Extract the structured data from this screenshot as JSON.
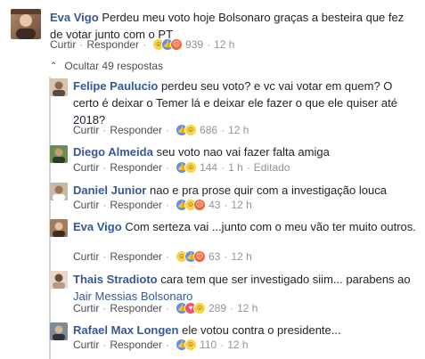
{
  "main_comment": {
    "author": "Eva Vigo",
    "text": "Perdeu meu voto hoje Bolsonaro graças a besteira que fez de votar junto com o PT",
    "like": "Curtir",
    "reply": "Responder",
    "reaction_count": "939",
    "time": "12 h",
    "reactions": [
      "haha",
      "like",
      "angry"
    ]
  },
  "toggle": {
    "label": "Ocultar 49 respostas"
  },
  "replies": [
    {
      "author": "Felipe Paulucio",
      "text": "perdeu seu voto? e vc vai votar em quem? O certo é deixar o Temer lá e deixar ele fazer o que ele quiser até 2018?",
      "like": "Curtir",
      "reply": "Responder",
      "reaction_count": "686",
      "time": "12 h",
      "edited": "",
      "reactions": [
        "like",
        "haha"
      ]
    },
    {
      "author": "Diego Almeida",
      "text": "seu voto nao vai fazer falta amiga",
      "like": "Curtir",
      "reply": "Responder",
      "reaction_count": "144",
      "time": "1 h",
      "edited": "Editado",
      "reactions": [
        "like",
        "haha"
      ]
    },
    {
      "author": "Daniel Junior",
      "text": "nao e pra prose quir com a investigação louca",
      "like": "Curtir",
      "reply": "Responder",
      "reaction_count": "43",
      "time": "12 h",
      "edited": "",
      "reactions": [
        "like",
        "haha",
        "angry"
      ]
    },
    {
      "author": "Eva Vigo",
      "text": "Com serteza vai ...junto com o meu vão ter muito outros.",
      "like": "Curtir",
      "reply": "Responder",
      "reaction_count": "63",
      "time": "12 h",
      "edited": "",
      "reactions": [
        "haha",
        "like",
        "angry"
      ]
    },
    {
      "author": "Thais Stradioto",
      "text": "cara tem que ser investigado siim... parabens ao",
      "mention": "Jair Messias Bolsonaro",
      "like": "Curtir",
      "reply": "Responder",
      "reaction_count": "289",
      "time": "12 h",
      "edited": "",
      "reactions": [
        "like",
        "love",
        "haha"
      ]
    },
    {
      "author": "Rafael Max Longen",
      "text": "ele votou contra o presidente...",
      "like": "Curtir",
      "reply": "Responder",
      "reaction_count": "110",
      "time": "12 h",
      "edited": "",
      "reactions": [
        "like",
        "haha"
      ]
    }
  ],
  "colors": {
    "name": "#365899",
    "meta": "#90949c",
    "thread_line": "#d1d5db"
  }
}
